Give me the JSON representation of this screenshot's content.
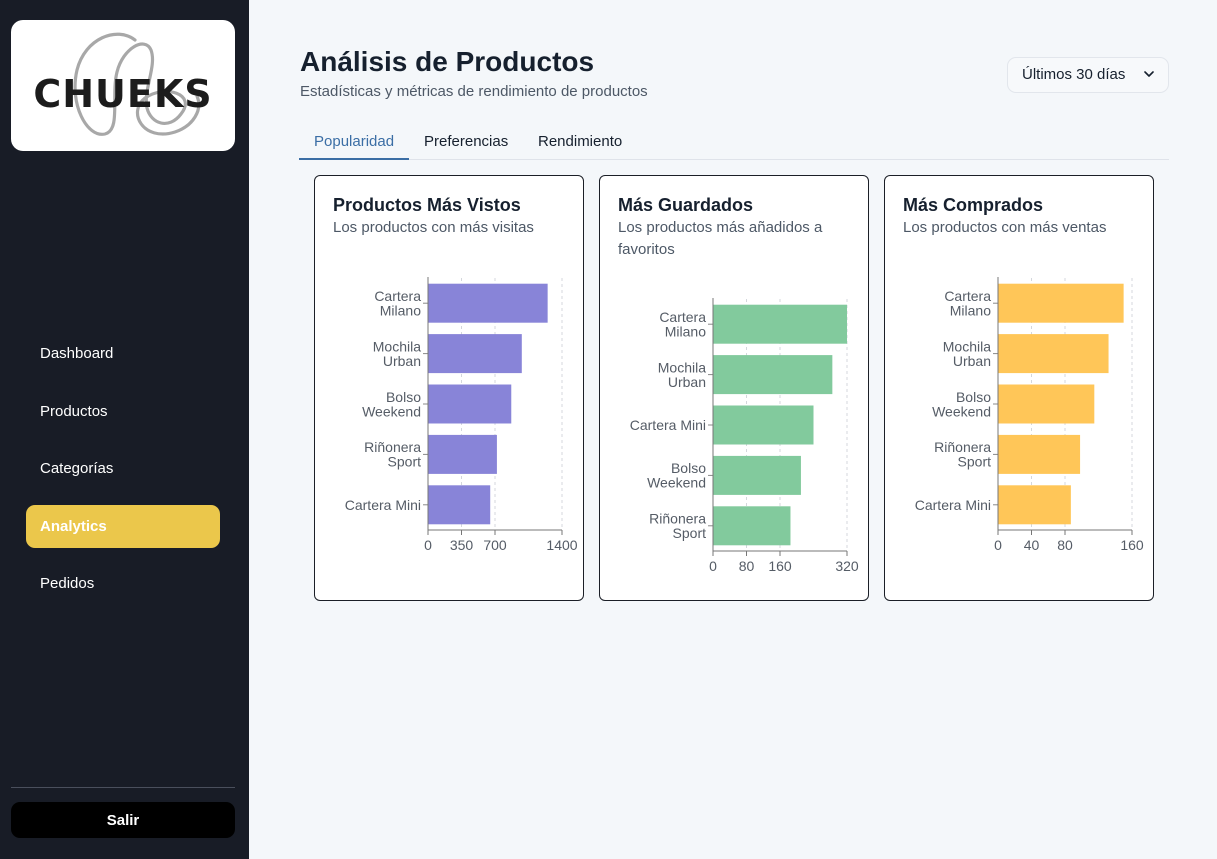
{
  "brand": {
    "name": "CHUEKS"
  },
  "sidebar": {
    "items": [
      {
        "label": "Dashboard",
        "active": false
      },
      {
        "label": "Productos",
        "active": false
      },
      {
        "label": "Categorías",
        "active": false
      },
      {
        "label": "Analytics",
        "active": true
      },
      {
        "label": "Pedidos",
        "active": false
      }
    ],
    "logout_label": "Salir",
    "active_color": "#ebc74b"
  },
  "header": {
    "title": "Análisis de Productos",
    "subtitle": "Estadísticas y métricas de rendimiento de productos",
    "range": {
      "selected": "Últimos 30 días",
      "icon": "chevron-down-icon"
    }
  },
  "tabs": [
    {
      "label": "Popularidad",
      "active": true
    },
    {
      "label": "Preferencias",
      "active": false
    },
    {
      "label": "Rendimiento",
      "active": false
    }
  ],
  "cards": [
    {
      "title": "Productos Más Vistos",
      "subtitle": "Los productos con más visitas"
    },
    {
      "title": "Más Guardados",
      "subtitle": "Los productos más añadidos a favoritos"
    },
    {
      "title": "Más Comprados",
      "subtitle": "Los productos con más ventas"
    }
  ],
  "chart_data": [
    {
      "type": "bar",
      "orientation": "horizontal",
      "color": "#8884d8",
      "categories": [
        "Cartera Milano",
        "Mochila Urban",
        "Bolso Weekend",
        "Riñonera Sport",
        "Cartera Mini"
      ],
      "values": [
        1250,
        980,
        870,
        720,
        650
      ],
      "xticks": [
        0,
        350,
        700,
        1400
      ],
      "xlim": [
        0,
        1400
      ],
      "grid": true
    },
    {
      "type": "bar",
      "orientation": "horizontal",
      "color": "#82ca9d",
      "categories": [
        "Cartera Milano",
        "Mochila Urban",
        "Cartera Mini",
        "Bolso Weekend",
        "Riñonera Sport"
      ],
      "values": [
        320,
        285,
        240,
        210,
        185
      ],
      "xticks": [
        0,
        80,
        160,
        320
      ],
      "xlim": [
        0,
        320
      ],
      "grid": true
    },
    {
      "type": "bar",
      "orientation": "horizontal",
      "color": "#ffc658",
      "categories": [
        "Cartera Milano",
        "Mochila Urban",
        "Bolso Weekend",
        "Riñonera Sport",
        "Cartera Mini"
      ],
      "values": [
        150,
        132,
        115,
        98,
        87
      ],
      "xticks": [
        0,
        40,
        80,
        160
      ],
      "xlim": [
        0,
        160
      ],
      "grid": true
    }
  ]
}
